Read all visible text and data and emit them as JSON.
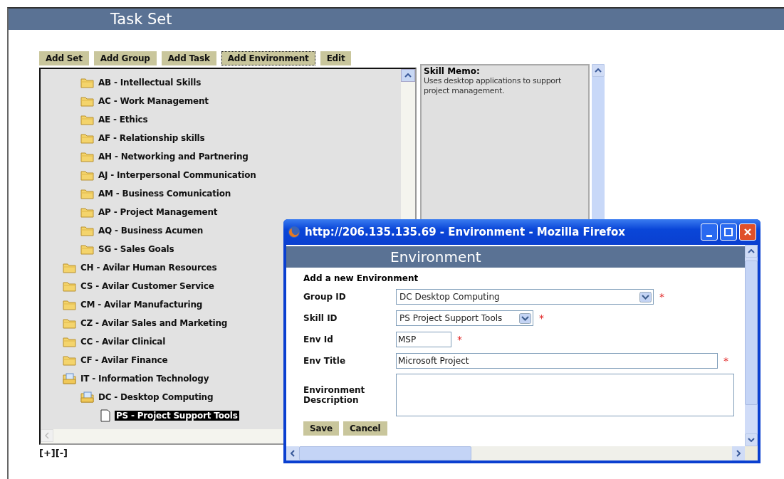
{
  "page": {
    "title": "Task Set"
  },
  "toolbar": [
    {
      "label": "Add Set",
      "focused": false
    },
    {
      "label": "Add Group",
      "focused": false
    },
    {
      "label": "Add Task",
      "focused": false
    },
    {
      "label": "Add Environment",
      "focused": true
    },
    {
      "label": "Edit",
      "focused": false
    }
  ],
  "tree": {
    "continued_children": [
      {
        "label": "AB - Intellectual Skills",
        "kind": "folder",
        "expanded": false,
        "selected": false
      },
      {
        "label": "AC - Work Management",
        "kind": "folder",
        "expanded": false,
        "selected": false
      },
      {
        "label": "AE - Ethics",
        "kind": "folder",
        "expanded": false,
        "selected": false
      },
      {
        "label": "AF - Relationship skills",
        "kind": "folder",
        "expanded": false,
        "selected": false
      },
      {
        "label": "AH - Networking and Partnering",
        "kind": "folder",
        "expanded": false,
        "selected": false
      },
      {
        "label": "AJ - Interpersonal Communication",
        "kind": "folder",
        "expanded": false,
        "selected": false
      },
      {
        "label": "AM - Business Comunication",
        "kind": "folder",
        "expanded": false,
        "selected": false
      },
      {
        "label": "AP - Project Management",
        "kind": "folder",
        "expanded": false,
        "selected": false
      },
      {
        "label": "AQ - Business Acumen",
        "kind": "folder",
        "expanded": false,
        "selected": false
      },
      {
        "label": "SG - Sales Goals",
        "kind": "folder",
        "expanded": false,
        "selected": false
      }
    ],
    "items": [
      {
        "label": "CH - Avilar Human Resources",
        "kind": "folder",
        "expanded": false,
        "selected": false
      },
      {
        "label": "CS - Avilar Customer Service",
        "kind": "folder",
        "expanded": false,
        "selected": false
      },
      {
        "label": "CM - Avilar Manufacturing",
        "kind": "folder",
        "expanded": false,
        "selected": false
      },
      {
        "label": "CZ - Avilar Sales and Marketing",
        "kind": "folder",
        "expanded": false,
        "selected": false
      },
      {
        "label": "CC - Avilar Clinical",
        "kind": "folder",
        "expanded": false,
        "selected": false
      },
      {
        "label": "CF - Avilar Finance",
        "kind": "folder",
        "expanded": false,
        "selected": false
      },
      {
        "label": "IT - Information Technology",
        "kind": "folder",
        "expanded": true,
        "selected": false,
        "children": [
          {
            "label": "DC - Desktop Computing",
            "kind": "folder",
            "expanded": true,
            "selected": false,
            "children": [
              {
                "label": "PS - Project Support Tools",
                "kind": "document",
                "selected": true
              }
            ]
          }
        ]
      }
    ]
  },
  "tree_controls": [
    "[+]",
    "[-]"
  ],
  "skill_memo": {
    "heading": "Skill Memo:",
    "text": "Uses desktop applications to support project management."
  },
  "popup": {
    "title": "http://206.135.135.69 - Environment - Mozilla Firefox",
    "header": "Environment",
    "form_title": "Add a new Environment",
    "fields": [
      {
        "label": "Group ID",
        "kind": "select",
        "value": "DC Desktop Computing",
        "required": true
      },
      {
        "label": "Skill ID",
        "kind": "select",
        "value": "PS Project Support Tools",
        "required": true
      },
      {
        "label": "Env Id",
        "kind": "text",
        "value": "MSP",
        "required": true
      },
      {
        "label": "Env Title",
        "kind": "text",
        "value": "Microsoft Project",
        "required": true
      },
      {
        "label": "Environment Description",
        "kind": "textarea",
        "required": false
      }
    ],
    "required_mark": "*",
    "buttons": [
      "Save",
      "Cancel"
    ]
  }
}
